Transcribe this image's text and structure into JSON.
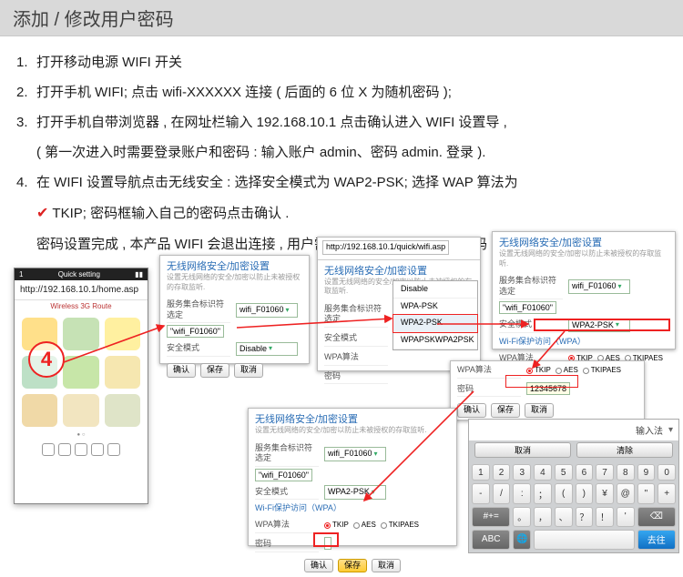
{
  "header": "添加 / 修改用户密码",
  "steps": {
    "s1": {
      "num": "1.",
      "text": "打开移动电源 WIFI 开关"
    },
    "s2": {
      "num": "2.",
      "text": "打开手机 WIFI; 点击 wifi-XXXXXX 连接 ( 后面的 6 位 X 为随机密码 );"
    },
    "s3": {
      "num": "3.",
      "text": "打开手机自带浏览器 , 在网址栏输入 192.168.10.1 点击确认进入 WIFI 设置导 ,"
    },
    "s3b": "( 第一次进入时需要登录账户和密码 : 输入账户 admin、密码 admin. 登录 ).",
    "s4": {
      "num": "4.",
      "text": "在 WIFI 设置导航点击无线安全 : 选择安全模式为 WAP2-PSK; 选择 WAP 算法为"
    },
    "s4b": "TKIP; 密码框输入自己的密码点击确认 .",
    "s4c": "密码设置完成 , 本产品 WIFI 会退出连接 , 用户需重新连接 WIFI 并输入密码 ."
  },
  "phone": {
    "statusL": "1",
    "statusTitle": "Quick setting",
    "url": "http://192.168.10.1/home.asp",
    "title": "Wireless 3G Route"
  },
  "callout": "4",
  "url": "http://192.168.10.1/quick/wifi.asp",
  "labels": {
    "section": "无线网络安全/加密设置",
    "sub": "设置无线网络的安全/加密以防止未被授权的存取监听.",
    "ssid": "服务集合标识符选定",
    "mode": "安全模式",
    "protect": "Wi-Fi保护访问（WPA）",
    "algo": "WPA算法",
    "pw": "密码"
  },
  "fields": {
    "ssidInput": "\"wifi_F01060\"",
    "ssidSelect": "wifi_F01060",
    "modeDisable": "Disable",
    "modeSelect": "WPA2-PSK",
    "algoTKIP": "TKIP",
    "algoAES": "AES",
    "algoMix": "TKIPAES",
    "pwVal": "12345678"
  },
  "dropdown": [
    "Disable",
    "WPA-PSK",
    "WPA2-PSK",
    "WPAPSKWPA2PSK"
  ],
  "buttons": {
    "apply": "确认",
    "save": "保存",
    "cancel": "取消"
  },
  "kb": {
    "suggest": "输入法",
    "cancel": "取消",
    "clear": "清除",
    "row1": [
      "1",
      "2",
      "3",
      "4",
      "5",
      "6",
      "7",
      "8",
      "9",
      "0"
    ],
    "row2": [
      "-",
      "/",
      ":",
      "；",
      "(",
      ")",
      "¥",
      "@",
      "\"",
      "+"
    ],
    "row3": [
      "。",
      "，",
      "、",
      "？",
      "！",
      "'",
      "⌫"
    ],
    "row4l": "ABC",
    "row4r": "去往",
    "space": ""
  }
}
